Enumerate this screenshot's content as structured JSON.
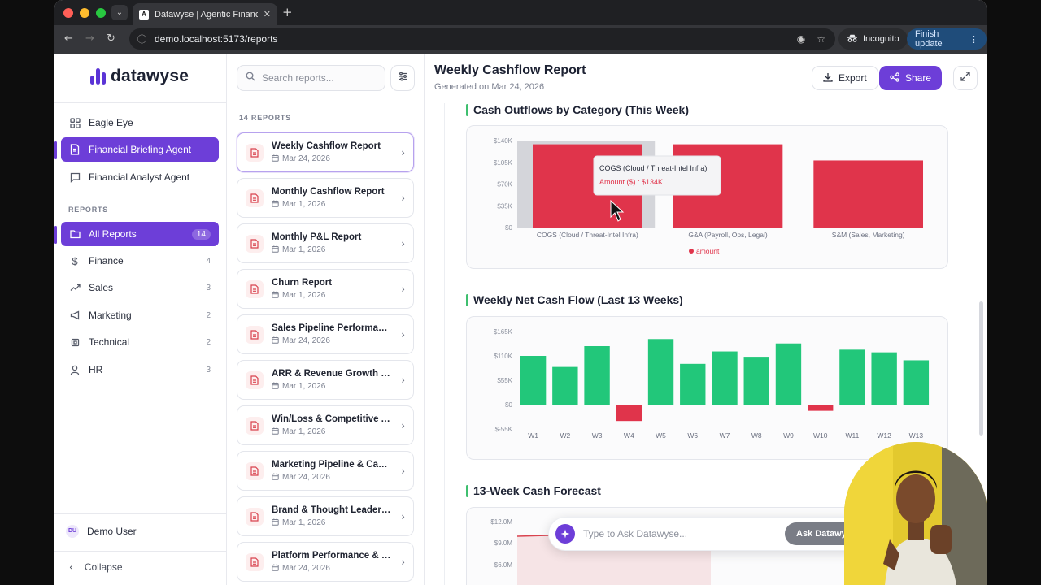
{
  "browser": {
    "tab_title": "Datawyse | Agentic Financial",
    "url": "demo.localhost:5173/reports",
    "incognito_label": "Incognito",
    "update_label": "Finish update"
  },
  "sidebar": {
    "brand": "datawyse",
    "agents": [
      {
        "label": "Eagle Eye",
        "icon": "grid-icon"
      },
      {
        "label": "Financial Briefing Agent",
        "icon": "document-icon"
      },
      {
        "label": "Financial Analyst Agent",
        "icon": "chat-icon"
      }
    ],
    "section_label": "REPORTS",
    "categories": [
      {
        "label": "All Reports",
        "count": "14",
        "icon": "folder-icon"
      },
      {
        "label": "Finance",
        "count": "4",
        "icon": "dollar-icon"
      },
      {
        "label": "Sales",
        "count": "3",
        "icon": "trend-icon"
      },
      {
        "label": "Marketing",
        "count": "2",
        "icon": "megaphone-icon"
      },
      {
        "label": "Technical",
        "count": "2",
        "icon": "chip-icon"
      },
      {
        "label": "HR",
        "count": "3",
        "icon": "person-icon"
      }
    ],
    "user": {
      "initials": "DU",
      "name": "Demo User"
    },
    "collapse_label": "Collapse"
  },
  "reports_panel": {
    "search_placeholder": "Search reports...",
    "count_label": "14 REPORTS",
    "items": [
      {
        "title": "Weekly Cashflow Report",
        "date": "Mar 24, 2026"
      },
      {
        "title": "Monthly Cashflow Report",
        "date": "Mar 1, 2026"
      },
      {
        "title": "Monthly P&L Report",
        "date": "Mar 1, 2026"
      },
      {
        "title": "Churn Report",
        "date": "Mar 1, 2026"
      },
      {
        "title": "Sales Pipeline Performanc...",
        "date": "Mar 24, 2026"
      },
      {
        "title": "ARR & Revenue Growth Re...",
        "date": "Mar 1, 2026"
      },
      {
        "title": "Win/Loss & Competitive A...",
        "date": "Mar 1, 2026"
      },
      {
        "title": "Marketing Pipeline & Cam...",
        "date": "Mar 24, 2026"
      },
      {
        "title": "Brand & Thought Leaders...",
        "date": "Mar 1, 2026"
      },
      {
        "title": "Platform Performance & R...",
        "date": "Mar 24, 2026"
      }
    ]
  },
  "main": {
    "title": "Weekly Cashflow Report",
    "subtitle": "Generated on Mar 24, 2026",
    "export_label": "Export",
    "share_label": "Share",
    "section1_title": "Cash Outflows by Category (This Week)",
    "section2_title": "Weekly Net Cash Flow (Last 13 Weeks)",
    "section3_title": "13-Week Cash Forecast",
    "tooltip_title": "COGS (Cloud / Threat-Intel Infra)",
    "tooltip_value": "Amount ($) : $134K",
    "ask_placeholder": "Type to Ask Datawyse...",
    "ask_button": "Ask Datawyse"
  },
  "colors": {
    "accent": "#6d3ed8",
    "outflow_bar": "#e0344b",
    "inflow_bar": "#22c77a",
    "section_marker": "#3fbf6f"
  },
  "chart_data": [
    {
      "type": "bar",
      "title": "Cash Outflows by Category (This Week)",
      "categories": [
        "COGS (Cloud / Threat-Intel Infra)",
        "G&A (Payroll, Ops, Legal)",
        "S&M (Sales, Marketing)"
      ],
      "series": [
        {
          "name": "amount",
          "values": [
            134,
            134,
            108
          ]
        }
      ],
      "ylim": [
        0,
        140
      ],
      "yticks": [
        "$0",
        "$35K",
        "$70K",
        "$105K",
        "$140K"
      ],
      "legend": "bottom-center"
    },
    {
      "type": "bar",
      "title": "Weekly Net Cash Flow (Last 13 Weeks)",
      "categories": [
        "W1",
        "W2",
        "W3",
        "W4",
        "W5",
        "W6",
        "W7",
        "W8",
        "W9",
        "W10",
        "W11",
        "W12",
        "W13"
      ],
      "series": [
        {
          "values": [
            110,
            85,
            132,
            -37,
            148,
            92,
            120,
            108,
            138,
            -14,
            124,
            118,
            100
          ]
        }
      ],
      "ylim": [
        -55,
        165
      ],
      "yticks": [
        "$-55K",
        "$0",
        "$55K",
        "$110K",
        "$165K"
      ]
    },
    {
      "type": "area",
      "title": "13-Week Cash Forecast",
      "yticks": [
        "$6.0M",
        "$9.0M",
        "$12.0M"
      ]
    }
  ]
}
